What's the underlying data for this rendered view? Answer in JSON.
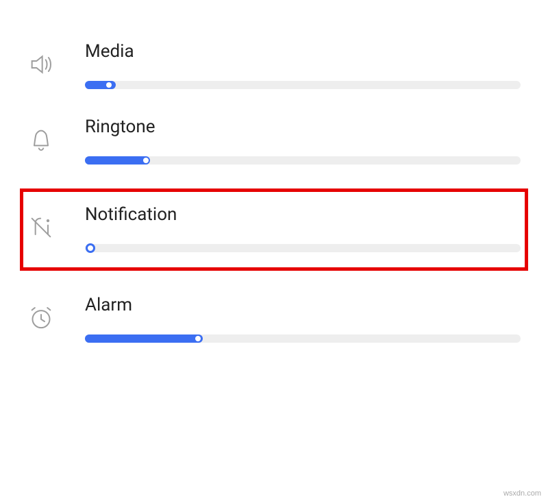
{
  "rows": [
    {
      "key": "media",
      "label": "Media",
      "value": 7,
      "icon": "speaker-icon",
      "highlighted": false
    },
    {
      "key": "ringtone",
      "label": "Ringtone",
      "value": 15,
      "icon": "bell-icon",
      "highlighted": false
    },
    {
      "key": "notification",
      "label": "Notification",
      "value": 0,
      "icon": "bell-off-icon",
      "highlighted": true
    },
    {
      "key": "alarm",
      "label": "Alarm",
      "value": 27,
      "icon": "clock-alarm-icon",
      "highlighted": false
    }
  ],
  "watermark": "wsxdn.com",
  "colors": {
    "accent": "#3b6ef2",
    "track": "#eeeeee",
    "highlight_border": "#e60000"
  }
}
